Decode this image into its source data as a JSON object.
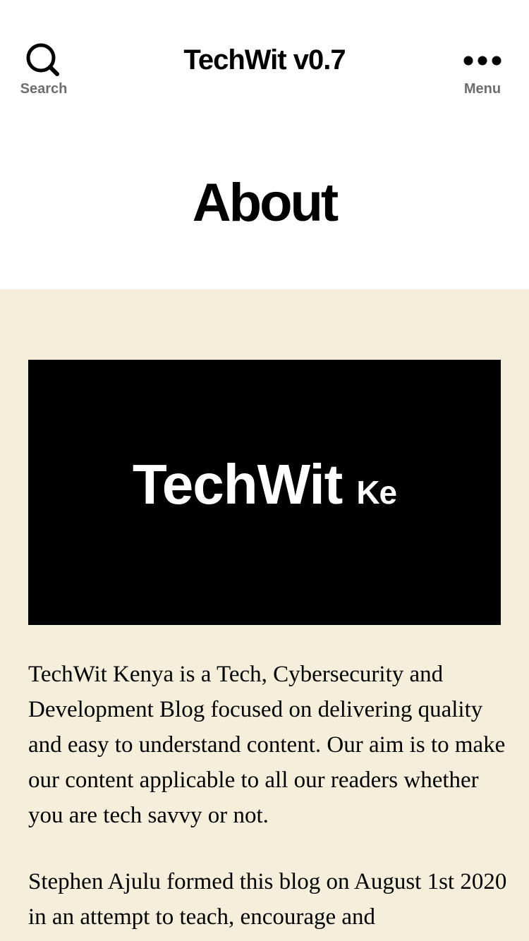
{
  "header": {
    "search_label": "Search",
    "site_title": "TechWit v0.7",
    "menu_label": "Menu",
    "search_icon": "search-icon",
    "menu_icon": "ellipsis-icon"
  },
  "page": {
    "title": "About"
  },
  "featured_image": {
    "logo_main": "TechWit",
    "logo_suffix": "Ke"
  },
  "content": {
    "paragraphs": [
      "TechWit Kenya is a Tech, Cybersecurity and Development Blog focused on delivering quality and easy to understand content. Our aim is to make our content applicable to all our readers whether you are tech savvy or not.",
      "Stephen Ajulu formed this blog on August 1st 2020 in an attempt to teach, encourage and"
    ]
  },
  "colors": {
    "content_background": "#f4eedb",
    "toggle_label": "#6d6d6d",
    "text": "#000000"
  }
}
